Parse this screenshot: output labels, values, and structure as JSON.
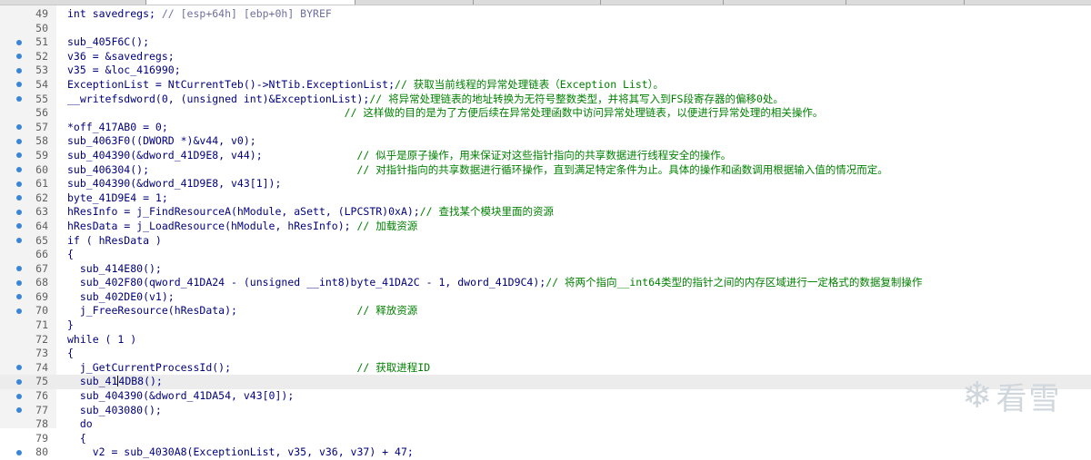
{
  "editor": {
    "lines": [
      {
        "num": "49",
        "dot": false,
        "segs": [
          {
            "t": "int savedregs; ",
            "c": "k"
          },
          {
            "t": "// [esp+64h] [ebp+0h] BYREF",
            "c": "g"
          }
        ]
      },
      {
        "num": "50",
        "dot": false,
        "segs": [
          {
            "t": "",
            "c": "k"
          }
        ]
      },
      {
        "num": "51",
        "dot": true,
        "segs": [
          {
            "t": "sub_405F6C();",
            "c": "k"
          }
        ]
      },
      {
        "num": "52",
        "dot": true,
        "segs": [
          {
            "t": "v36 = &savedregs;",
            "c": "k"
          }
        ]
      },
      {
        "num": "53",
        "dot": true,
        "segs": [
          {
            "t": "v35 = &loc_416990;",
            "c": "k"
          }
        ]
      },
      {
        "num": "54",
        "dot": true,
        "segs": [
          {
            "t": "ExceptionList = NtCurrentTeb()->NtTib.ExceptionList;",
            "c": "k"
          },
          {
            "t": "// 获取当前线程的异常处理链表（Exception List）。",
            "c": "c"
          }
        ]
      },
      {
        "num": "55",
        "dot": true,
        "segs": [
          {
            "t": "__writefsdword(0, (unsigned int)&ExceptionList);",
            "c": "k"
          },
          {
            "t": "// 将异常处理链表的地址转换为无符号整数类型，并将其写入到FS段寄存器的偏移0处。",
            "c": "c"
          }
        ]
      },
      {
        "num": "56",
        "dot": false,
        "segs": [
          {
            "t": "                                            ",
            "c": "k"
          },
          {
            "t": "// 这样做的目的是为了方便后续在异常处理函数中访问异常处理链表，以便进行异常处理的相关操作。",
            "c": "c"
          }
        ]
      },
      {
        "num": "57",
        "dot": true,
        "segs": [
          {
            "t": "*off_417AB0 = 0;",
            "c": "k"
          }
        ]
      },
      {
        "num": "58",
        "dot": true,
        "segs": [
          {
            "t": "sub_4063F0((DWORD *)&v44, v0);",
            "c": "k"
          }
        ]
      },
      {
        "num": "59",
        "dot": true,
        "segs": [
          {
            "t": "sub_404390(&dword_41D9E8, v44);               ",
            "c": "k"
          },
          {
            "t": "// 似乎是原子操作，用来保证对这些指针指向的共享数据进行线程安全的操作。",
            "c": "c"
          }
        ]
      },
      {
        "num": "60",
        "dot": true,
        "segs": [
          {
            "t": "sub_406304();                                 ",
            "c": "k"
          },
          {
            "t": "// 对指针指向的共享数据进行循环操作，直到满足特定条件为止。具体的操作和函数调用根据输入值的情况而定。",
            "c": "c"
          }
        ]
      },
      {
        "num": "61",
        "dot": true,
        "segs": [
          {
            "t": "sub_404390(&dword_41D9E8, v43[1]);",
            "c": "k"
          }
        ]
      },
      {
        "num": "62",
        "dot": true,
        "segs": [
          {
            "t": "byte_41D9E4 = 1;",
            "c": "k"
          }
        ]
      },
      {
        "num": "63",
        "dot": true,
        "segs": [
          {
            "t": "hResInfo = j_FindResourceA(hModule, aSett, (LPCSTR)0xA);",
            "c": "k"
          },
          {
            "t": "// 查找某个模块里面的资源",
            "c": "c"
          }
        ]
      },
      {
        "num": "64",
        "dot": true,
        "segs": [
          {
            "t": "hResData = j_LoadResource(hModule, hResInfo); ",
            "c": "k"
          },
          {
            "t": "// 加载资源",
            "c": "c"
          }
        ]
      },
      {
        "num": "65",
        "dot": true,
        "segs": [
          {
            "t": "if ( hResData )",
            "c": "k"
          }
        ]
      },
      {
        "num": "66",
        "dot": false,
        "segs": [
          {
            "t": "{",
            "c": "k"
          }
        ]
      },
      {
        "num": "67",
        "dot": true,
        "segs": [
          {
            "t": "  sub_414E80();",
            "c": "k"
          }
        ]
      },
      {
        "num": "68",
        "dot": true,
        "segs": [
          {
            "t": "  sub_402F80(qword_41DA24 - (unsigned __int8)byte_41DA2C - 1, dword_41D9C4);",
            "c": "k"
          },
          {
            "t": "// 将两个指向__int64类型的指针之间的内存区域进行一定格式的数据复制操作",
            "c": "c"
          }
        ]
      },
      {
        "num": "69",
        "dot": true,
        "segs": [
          {
            "t": "  sub_402DE0(v1);",
            "c": "k"
          }
        ]
      },
      {
        "num": "70",
        "dot": true,
        "segs": [
          {
            "t": "  j_FreeResource(hResData);                   ",
            "c": "k"
          },
          {
            "t": "// 释放资源",
            "c": "c"
          }
        ]
      },
      {
        "num": "71",
        "dot": false,
        "segs": [
          {
            "t": "}",
            "c": "k"
          }
        ]
      },
      {
        "num": "72",
        "dot": false,
        "segs": [
          {
            "t": "while ( 1 )",
            "c": "k"
          }
        ]
      },
      {
        "num": "73",
        "dot": false,
        "segs": [
          {
            "t": "{",
            "c": "k"
          }
        ]
      },
      {
        "num": "74",
        "dot": true,
        "segs": [
          {
            "t": "  j_GetCurrentProcessId();                    ",
            "c": "k"
          },
          {
            "t": "// 获取进程ID",
            "c": "c"
          }
        ]
      },
      {
        "num": "75",
        "dot": true,
        "current": true,
        "segs": [
          {
            "t": "  sub_41",
            "c": "k"
          },
          {
            "t": "|",
            "c": "caret"
          },
          {
            "t": "4DB8();",
            "c": "k"
          }
        ]
      },
      {
        "num": "76",
        "dot": true,
        "segs": [
          {
            "t": "  sub_404390(&dword_41DA54, v43[0]);",
            "c": "k"
          }
        ]
      },
      {
        "num": "77",
        "dot": true,
        "segs": [
          {
            "t": "  sub_403080();",
            "c": "k"
          }
        ]
      },
      {
        "num": "78",
        "dot": false,
        "segs": [
          {
            "t": "  do",
            "c": "k"
          }
        ]
      },
      {
        "num": "79",
        "dot": false,
        "segs": [
          {
            "t": "  {",
            "c": "k"
          }
        ]
      },
      {
        "num": "80",
        "dot": true,
        "segs": [
          {
            "t": "    v2 = sub_4030A8(ExceptionList, v35, v36, v37) + 47;",
            "c": "k"
          }
        ]
      }
    ]
  },
  "watermark": {
    "text": "看雪",
    "icon": "snowflake-icon"
  },
  "colors": {
    "keyword": "#00007f",
    "comment": "#008000",
    "gray_var": "#6f6f9f",
    "dot": "#3a86d6"
  }
}
